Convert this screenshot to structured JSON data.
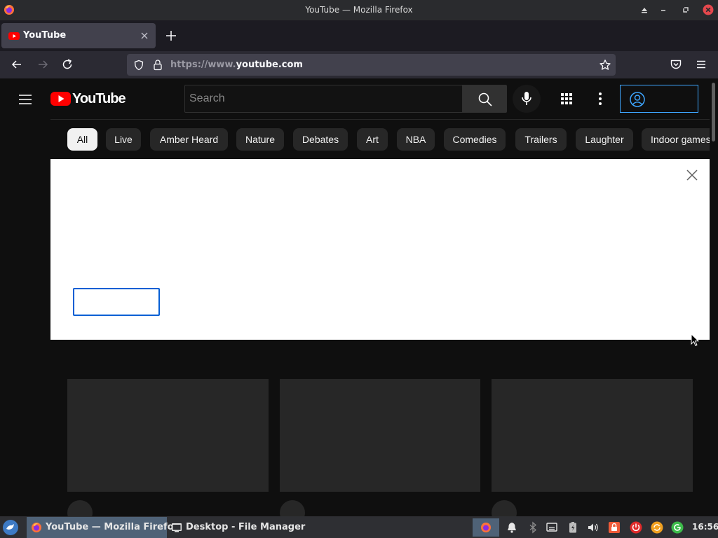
{
  "window": {
    "title": "YouTube — Mozilla Firefox"
  },
  "browser": {
    "tab_title": "YouTube",
    "url_prefix": "https://www.",
    "url_domain": "youtube.com"
  },
  "youtube": {
    "logo_text": "YouTube",
    "search_placeholder": "Search",
    "chips": [
      "All",
      "Live",
      "Amber Heard",
      "Nature",
      "Debates",
      "Art",
      "NBA",
      "Comedies",
      "Trailers",
      "Laughter",
      "Indoor games"
    ],
    "active_chip": "All"
  },
  "taskbar": {
    "tasks": [
      "YouTube — Mozilla Firefox",
      "Desktop - File Manager"
    ],
    "clock": "16:56"
  },
  "colors": {
    "youtube_red": "#ff0000",
    "signin_blue": "#3ea6ff",
    "consent_button_blue": "#065fd4",
    "page_background": "#0f0f0f"
  }
}
